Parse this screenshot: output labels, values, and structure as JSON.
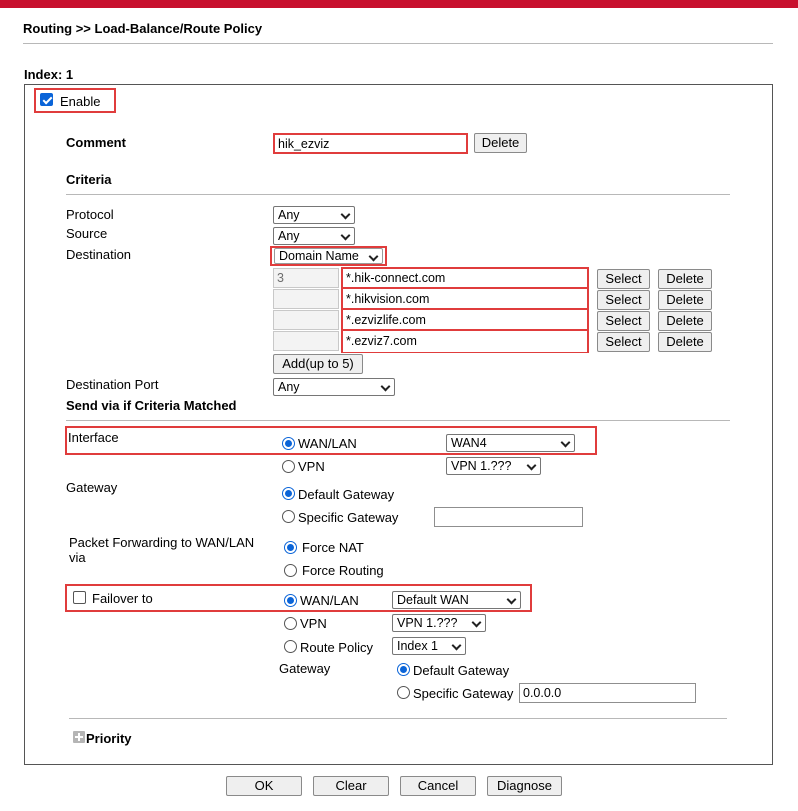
{
  "header": {
    "breadcrumb": "Routing >> Load-Balance/Route Policy"
  },
  "index_label": "Index: 1",
  "enable": {
    "label": "Enable",
    "checked": true
  },
  "comment": {
    "label": "Comment",
    "value": "hik_ezviz",
    "delete_label": "Delete"
  },
  "criteria": {
    "title": "Criteria",
    "protocol": {
      "label": "Protocol",
      "value": "Any"
    },
    "source": {
      "label": "Source",
      "value": "Any"
    },
    "destination": {
      "label": "Destination",
      "value": "Domain Name",
      "count": "3",
      "domains": [
        "*.hik-connect.com",
        "*.hikvision.com",
        "*.ezvizlife.com",
        "*.ezviz7.com"
      ],
      "select_label": "Select",
      "delete_label": "Delete",
      "add_label": "Add(up to 5)"
    },
    "destination_port": {
      "label": "Destination Port",
      "value": "Any"
    }
  },
  "send_via": {
    "title": "Send via if Criteria Matched",
    "interface": {
      "label": "Interface",
      "wan_lan_label": "WAN/LAN",
      "wan_value": "WAN4",
      "vpn_label": "VPN",
      "vpn_value": "VPN 1.???"
    },
    "gateway": {
      "label": "Gateway",
      "default_label": "Default Gateway",
      "specific_label": "Specific Gateway",
      "specific_value": ""
    },
    "packet_forwarding": {
      "label_line1": "Packet Forwarding to WAN/LAN",
      "label_line2": "via",
      "force_nat": "Force NAT",
      "force_routing": "Force Routing"
    },
    "failover": {
      "label": "Failover to",
      "checked": false,
      "wan_lan_label": "WAN/LAN",
      "wan_value": "Default WAN",
      "vpn_label": "VPN",
      "vpn_value": "VPN 1.???",
      "route_policy_label": "Route Policy",
      "route_policy_value": "Index 1",
      "gateway_label": "Gateway",
      "default_gateway_label": "Default Gateway",
      "specific_gateway_label": "Specific Gateway",
      "specific_gateway_value": "0.0.0.0"
    }
  },
  "priority": {
    "label": "Priority"
  },
  "footer": {
    "ok": "OK",
    "clear": "Clear",
    "cancel": "Cancel",
    "diagnose": "Diagnose"
  },
  "colors": {
    "brand_bar": "#c8102e",
    "highlight": "#e03c3c",
    "radio_accent": "#0a64d8"
  }
}
